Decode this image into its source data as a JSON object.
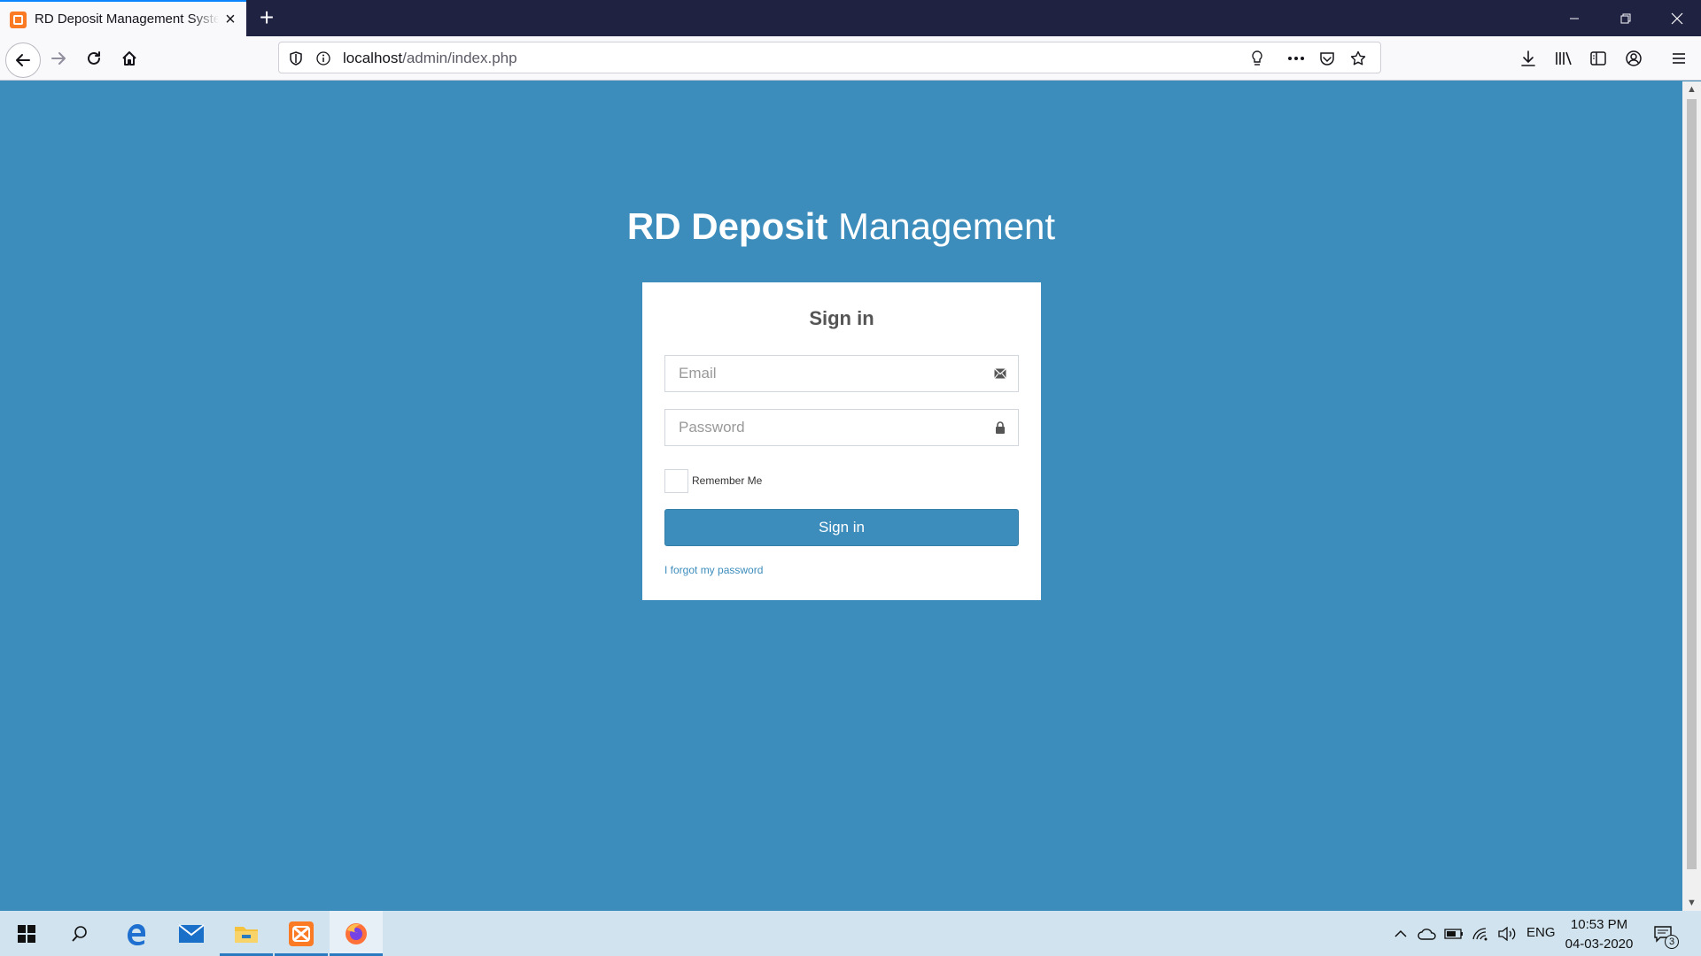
{
  "browser": {
    "tab_title": "RD Deposit Management System",
    "new_tab_symbol": "+",
    "url_host": "localhost",
    "url_path": "/admin/index.php"
  },
  "page": {
    "logo_bold": "RD Deposit",
    "logo_light": "Management",
    "login_title": "Sign in",
    "email_placeholder": "Email",
    "password_placeholder": "Password",
    "remember_label": "Remember Me",
    "signin_button": "Sign in",
    "forgot_link": "I forgot my password"
  },
  "taskbar": {
    "language": "ENG",
    "time": "10:53 PM",
    "date": "04-03-2020",
    "notification_count": "3"
  },
  "colors": {
    "page_background": "#3c8dbc",
    "primary_button": "#3c8dbc",
    "titlebar": "#1f2240"
  }
}
